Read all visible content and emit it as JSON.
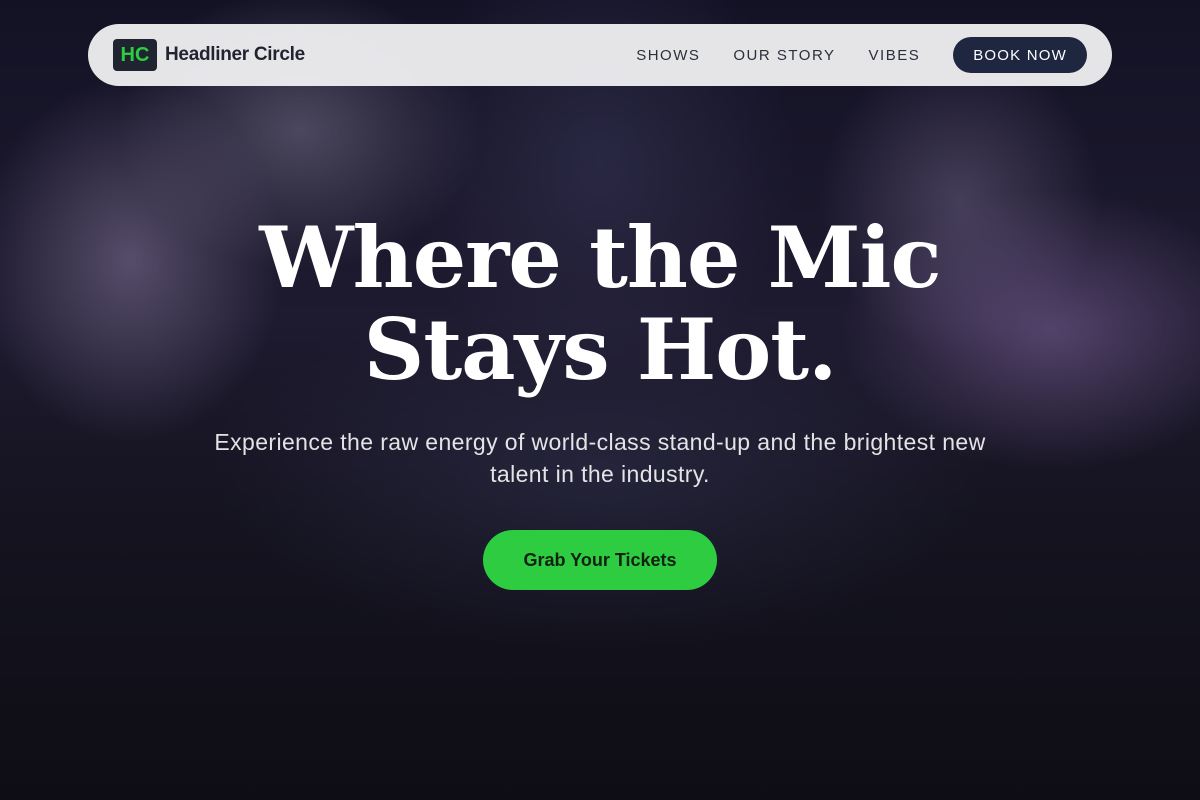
{
  "brand": {
    "logo_text": "HC",
    "name": "Headliner Circle"
  },
  "nav": {
    "links": [
      "SHOWS",
      "OUR STORY",
      "VIBES"
    ],
    "book_label": "BOOK NOW"
  },
  "hero": {
    "headline_line1": "Where the Mic",
    "headline_line2": "Stays Hot.",
    "subtitle": "Experience the raw energy of world-class stand-up and the brightest new talent in the industry.",
    "cta_label": "Grab Your Tickets"
  },
  "colors": {
    "accent": "#2ecc40",
    "navy": "#1f2640",
    "nav_bg": "#f0f0f2"
  }
}
